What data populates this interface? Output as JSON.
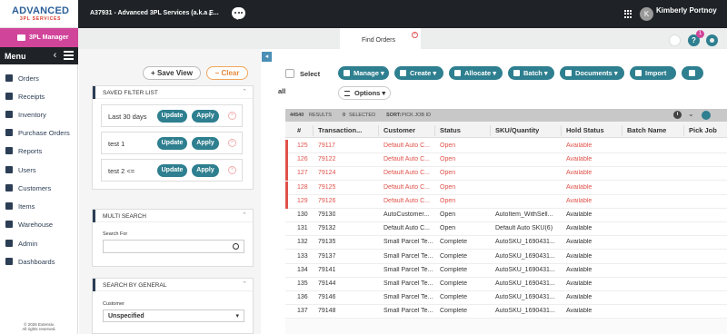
{
  "brand": {
    "name": "ADVANCED",
    "sub": "3PL SERVICES"
  },
  "account": {
    "label": "A37931 - Advanced 3PL Services (a.k.a E...",
    "chevron": "⌄"
  },
  "user": {
    "initial": "K",
    "name": "Kimberly Portnoy"
  },
  "help_badge": "1",
  "help_label": "?",
  "tpl_manager": "3PL Manager",
  "tab": {
    "label": "Find Orders",
    "close": "×"
  },
  "menu": {
    "title": "Menu",
    "items": [
      {
        "label": "Orders",
        "icon": "orders-icon"
      },
      {
        "label": "Receipts",
        "icon": "receipts-icon"
      },
      {
        "label": "Inventory",
        "icon": "inventory-icon"
      },
      {
        "label": "Purchase Orders",
        "icon": "purchase-orders-icon"
      },
      {
        "label": "Reports",
        "icon": "reports-icon"
      },
      {
        "label": "Users",
        "icon": "users-icon"
      },
      {
        "label": "Customers",
        "icon": "customers-icon"
      },
      {
        "label": "Items",
        "icon": "items-icon"
      },
      {
        "label": "Warehouse",
        "icon": "warehouse-icon"
      },
      {
        "label": "Admin",
        "icon": "admin-icon"
      },
      {
        "label": "Dashboards",
        "icon": "dashboards-icon"
      }
    ],
    "copyright_line1": "© 2026 Extensiv.",
    "copyright_line2": "All rights reserved."
  },
  "filters": {
    "save_view": "+ Save View",
    "clear": "− Clear",
    "saved_title": "SAVED FILTER LIST",
    "saved": [
      {
        "name": "Last 30 days"
      },
      {
        "name": "test 1"
      },
      {
        "name": "test 2 <="
      }
    ],
    "update_label": "Update",
    "apply_label": "Apply",
    "remove_label": "×",
    "multi_title": "MULTI SEARCH",
    "search_for_label": "Search For",
    "search_value": "",
    "general_title": "SEARCH BY GENERAL",
    "customer_label": "Customer",
    "customer_value": "Unspecified",
    "caret_up": "⌃",
    "caret_down": "▾"
  },
  "collapse": "◂",
  "toolbar": {
    "select": "Select",
    "all": "all",
    "manage": "Manage ▾",
    "create": "Create ▾",
    "allocate": "Allocate ▾",
    "batch": "Batch ▾",
    "documents": "Documents ▾",
    "import": "Import",
    "options": "Options ▾"
  },
  "grid": {
    "results_count": "44540",
    "results_label": "RESULTS",
    "selected_count": "0",
    "selected_label": "SELECTED",
    "sort_label": "SORT:",
    "sort_value": "PICK JOB ID",
    "info_icon": "i",
    "columns": [
      "#",
      "Transaction...",
      "Customer",
      "Status",
      "SKU/Quantity",
      "Hold Status",
      "Batch Name",
      "Pick Job"
    ],
    "rows": [
      {
        "num": "125",
        "txn": "79117",
        "customer": "Default Auto C...",
        "status": "Open",
        "sku": "",
        "hold": "Available",
        "red": true
      },
      {
        "num": "126",
        "txn": "79122",
        "customer": "Default Auto C...",
        "status": "Open",
        "sku": "",
        "hold": "Available",
        "red": true
      },
      {
        "num": "127",
        "txn": "79124",
        "customer": "Default Auto C...",
        "status": "Open",
        "sku": "",
        "hold": "Available",
        "red": true
      },
      {
        "num": "128",
        "txn": "79125",
        "customer": "Default Auto C...",
        "status": "Open",
        "sku": "",
        "hold": "Available",
        "red": true
      },
      {
        "num": "129",
        "txn": "79126",
        "customer": "Default Auto C...",
        "status": "Open",
        "sku": "",
        "hold": "Available",
        "red": true
      },
      {
        "num": "130",
        "txn": "79130",
        "customer": "AutoCustomer...",
        "status": "Open",
        "sku": "AutoItem_WithSell...",
        "hold": "Available",
        "red": false
      },
      {
        "num": "131",
        "txn": "79132",
        "customer": "Default Auto C...",
        "status": "Open",
        "sku": "Default Auto SKU(6)",
        "hold": "Available",
        "red": false
      },
      {
        "num": "132",
        "txn": "79135",
        "customer": "Small Parcel Te...",
        "status": "Complete",
        "sku": "AutoSKU_1690431...",
        "hold": "Available",
        "red": false
      },
      {
        "num": "133",
        "txn": "79137",
        "customer": "Small Parcel Te...",
        "status": "Complete",
        "sku": "AutoSKU_1690431...",
        "hold": "Available",
        "red": false
      },
      {
        "num": "134",
        "txn": "79141",
        "customer": "Small Parcel Te...",
        "status": "Complete",
        "sku": "AutoSKU_1690431...",
        "hold": "Available",
        "red": false
      },
      {
        "num": "135",
        "txn": "79144",
        "customer": "Small Parcel Te...",
        "status": "Complete",
        "sku": "AutoSKU_1690431...",
        "hold": "Available",
        "red": false
      },
      {
        "num": "136",
        "txn": "79146",
        "customer": "Small Parcel Te...",
        "status": "Complete",
        "sku": "AutoSKU_1690431...",
        "hold": "Available",
        "red": false
      },
      {
        "num": "137",
        "txn": "79148",
        "customer": "Small Parcel Te...",
        "status": "Complete",
        "sku": "AutoSKU_1690431...",
        "hold": "Available",
        "red": false
      }
    ]
  },
  "colors": {
    "accent": "#2e7f8f",
    "brand_pink": "#d0459a",
    "error_red": "#e0524a",
    "dark": "#1f2327"
  }
}
